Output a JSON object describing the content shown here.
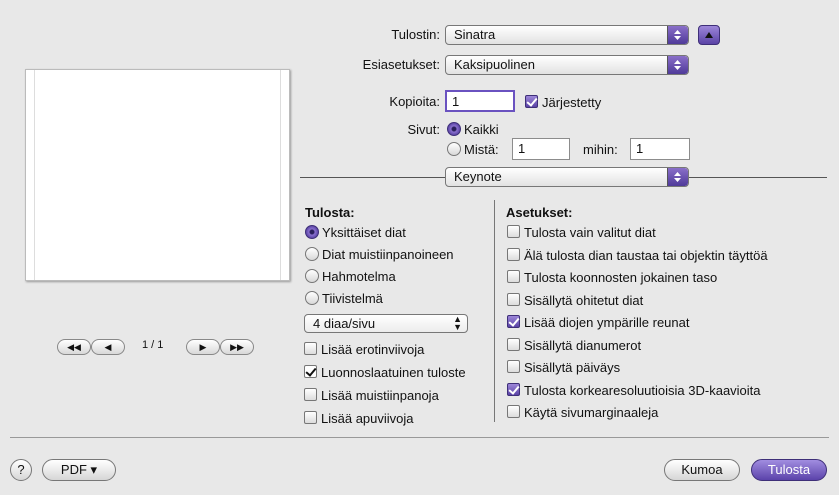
{
  "printer": {
    "label": "Tulostin:",
    "value": "Sinatra"
  },
  "presets": {
    "label": "Esiasetukset:",
    "value": "Kaksipuolinen"
  },
  "copies": {
    "label": "Kopioita:",
    "value": "1",
    "collated_label": "Järjestetty",
    "collated": true
  },
  "pages": {
    "label": "Sivut:",
    "all_label": "Kaikki",
    "from_label": "Mistä:",
    "from_value": "1",
    "to_label": "mihin:",
    "to_value": "1"
  },
  "section_popup": {
    "value": "Keynote"
  },
  "preview": {
    "page_indicator": "1 / 1"
  },
  "print_group": {
    "title": "Tulosta:",
    "options": [
      "Yksittäiset diat",
      "Diat muistiinpanoineen",
      "Hahmotelma",
      "Tiivistelmä"
    ],
    "selected_index": 0,
    "layout_popup": "4 diaa/sivu",
    "checkboxes": [
      {
        "label": "Lisää erotinviivoja",
        "checked": false
      },
      {
        "label": "Luonnoslaatuinen tuloste",
        "checked": true
      },
      {
        "label": "Lisää muistiinpanoja",
        "checked": false
      },
      {
        "label": "Lisää apuviivoja",
        "checked": false
      }
    ]
  },
  "settings_group": {
    "title": "Asetukset:",
    "checkboxes": [
      {
        "label": "Tulosta vain valitut diat",
        "checked": false
      },
      {
        "label": "Älä tulosta dian taustaa tai objektin täyttöä",
        "checked": false
      },
      {
        "label": "Tulosta koonnosten jokainen taso",
        "checked": false
      },
      {
        "label": "Sisällytä ohitetut diat",
        "checked": false
      },
      {
        "label": "Lisää diojen ympärille reunat",
        "checked": true
      },
      {
        "label": "Sisällytä dianumerot",
        "checked": false
      },
      {
        "label": "Sisällytä päiväys",
        "checked": false
      },
      {
        "label": "Tulosta korkearesoluutioisia 3D-kaavioita",
        "checked": true
      },
      {
        "label": "Käytä sivumarginaaleja",
        "checked": false
      }
    ]
  },
  "footer": {
    "help": "?",
    "pdf_label": "PDF ▾",
    "cancel_label": "Kumoa",
    "print_label": "Tulosta"
  },
  "colors": {
    "accent": "#5b43aa",
    "background": "#e8e8e8"
  }
}
